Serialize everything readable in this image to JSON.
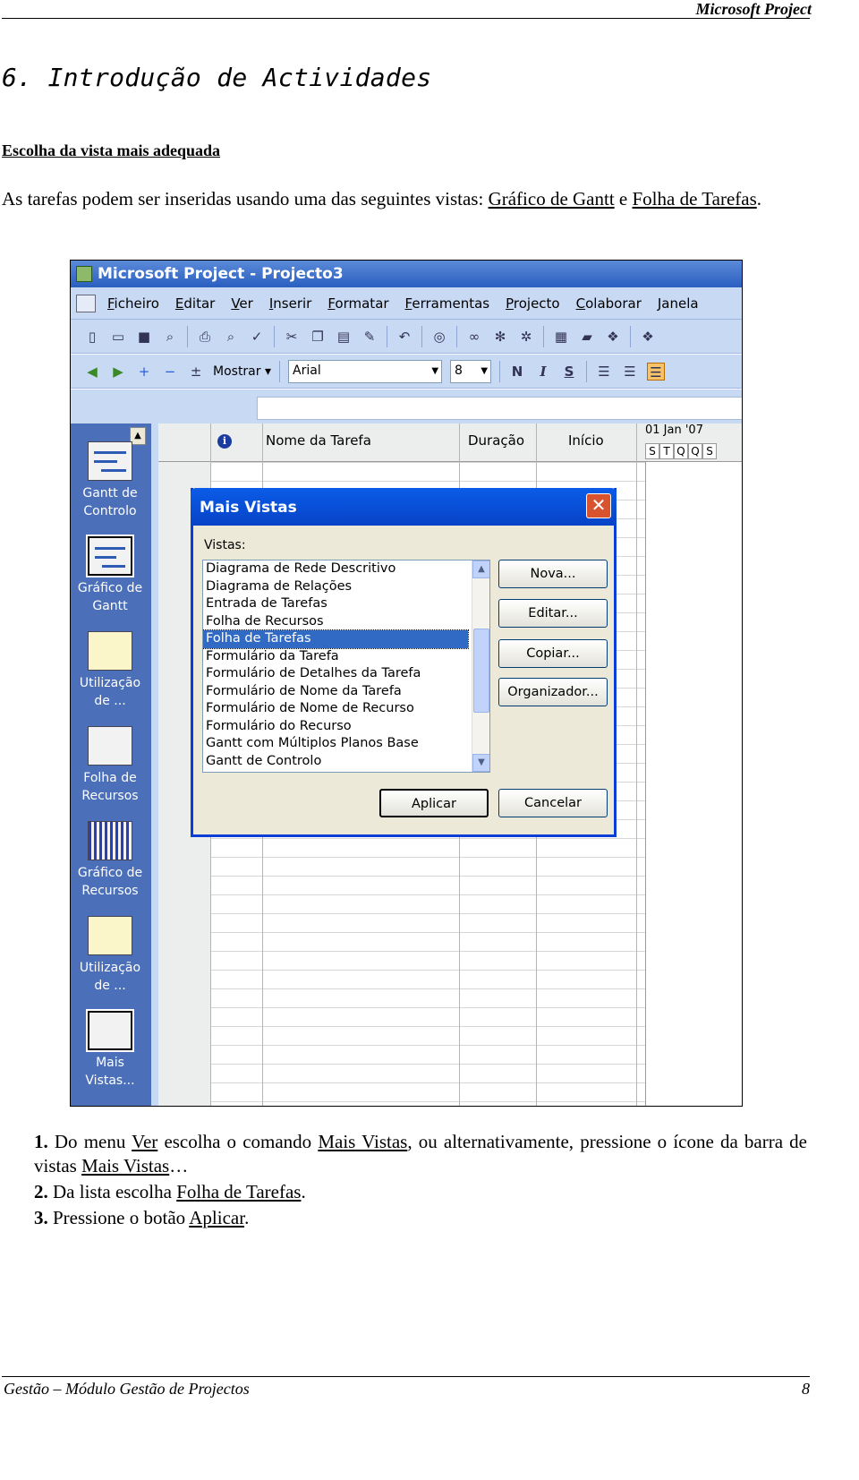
{
  "header": {
    "title": "Microsoft Project"
  },
  "section_title": "6. Introdução de Actividades",
  "subtitle": "Escolha da vista mais adequada",
  "intro": {
    "text1": "As tarefas podem ser inseridas usando uma das seguintes vistas: ",
    "link1": "Gráfico de Gantt",
    "text2": " e ",
    "link2": "Folha de Tarefas",
    "text3": "."
  },
  "app": {
    "title": "Microsoft Project - Projecto3",
    "menu": [
      "Ficheiro",
      "Editar",
      "Ver",
      "Inserir",
      "Formatar",
      "Ferramentas",
      "Projecto",
      "Colaborar",
      "Janela"
    ],
    "toolbar2": {
      "show_label": "Mostrar",
      "font_value": "Arial",
      "size_value": "8",
      "bold": "N",
      "italic": "I",
      "underline": "S"
    },
    "view_bar": [
      {
        "line1": "Gantt de",
        "line2": "Controlo"
      },
      {
        "line1": "Gráfico de",
        "line2": "Gantt"
      },
      {
        "line1": "Utilização",
        "line2": "de ..."
      },
      {
        "line1": "Folha de",
        "line2": "Recursos"
      },
      {
        "line1": "Gráfico de",
        "line2": "Recursos"
      },
      {
        "line1": "Utilização",
        "line2": "de ..."
      },
      {
        "line1": "Mais",
        "line2": "Vistas..."
      }
    ],
    "table_headers": {
      "name": "Nome da Tarefa",
      "duration": "Duração",
      "start": "Início"
    },
    "gantt_header": {
      "week": "01 Jan '07",
      "days": [
        "S",
        "T",
        "Q",
        "Q",
        "S"
      ]
    }
  },
  "dialog": {
    "title": "Mais Vistas",
    "views_label": "Vistas:",
    "items": [
      "Diagrama de Rede Descritivo",
      "Diagrama de Relações",
      "Entrada de Tarefas",
      "Folha de Recursos",
      "Folha de Tarefas",
      "Formulário da Tarefa",
      "Formulário de Detalhes da Tarefa",
      "Formulário de Nome da Tarefa",
      "Formulário de Nome de Recurso",
      "Formulário do Recurso",
      "Gantt com Múltiplos Planos Base",
      "Gantt de Controlo"
    ],
    "selected": "Folha de Tarefas",
    "buttons": {
      "new": "Nova...",
      "edit": "Editar...",
      "copy": "Copiar...",
      "organizer": "Organizador...",
      "apply": "Aplicar",
      "cancel": "Cancelar"
    }
  },
  "steps": {
    "s1": {
      "num": "1.",
      "a": " Do menu ",
      "l1": "Ver",
      "b": " escolha o comando ",
      "l2": "Mais Vistas",
      "c": ", ou alternativamente, pressione o ícone da barra de vistas ",
      "l3": "Mais Vistas",
      "d": "…"
    },
    "s2": {
      "num": "2.",
      "a": " Da lista escolha ",
      "l1": "Folha de Tarefas",
      "b": "."
    },
    "s3": {
      "num": "3.",
      "a": " Pressione o botão ",
      "l1": "Aplicar",
      "b": "."
    }
  },
  "footer": {
    "left": "Gestão – Módulo Gestão de Projectos",
    "page": "8"
  }
}
